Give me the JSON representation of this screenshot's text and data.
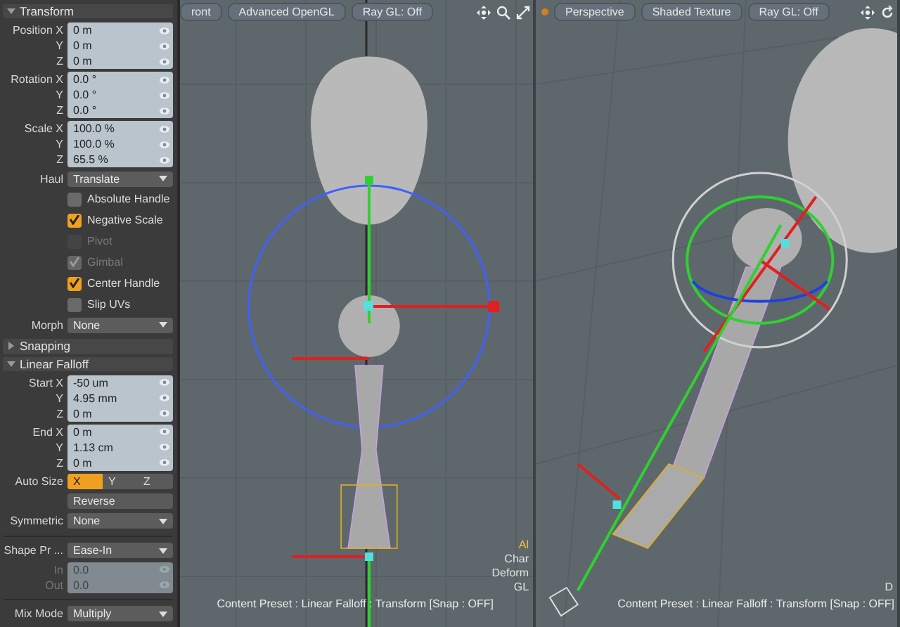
{
  "panel": {
    "sections": [
      {
        "title": "Transform",
        "expanded": true,
        "items": [
          {
            "kind": "vector",
            "disabled": false,
            "rows": [
              {
                "label": "Position X",
                "value": "0 m"
              },
              {
                "label": "Y",
                "value": "0 m"
              },
              {
                "label": "Z",
                "value": "0 m"
              }
            ]
          },
          {
            "kind": "vector",
            "disabled": false,
            "rows": [
              {
                "label": "Rotation X",
                "value": "0.0 °"
              },
              {
                "label": "Y",
                "value": "0.0 °"
              },
              {
                "label": "Z",
                "value": "0.0 °"
              }
            ]
          },
          {
            "kind": "vector",
            "disabled": false,
            "rows": [
              {
                "label": "Scale X",
                "value": "100.0 %"
              },
              {
                "label": "Y",
                "value": "100.0 %"
              },
              {
                "label": "Z",
                "value": "65.5 %"
              }
            ]
          },
          {
            "kind": "dropdown",
            "label": "Haul",
            "value": "Translate"
          },
          {
            "kind": "checkbox",
            "label": "Absolute Handle",
            "checked": false,
            "disabled": false
          },
          {
            "kind": "checkbox",
            "label": "Negative Scale",
            "checked": true,
            "disabled": false
          },
          {
            "kind": "checkbox",
            "label": "Pivot",
            "checked": false,
            "disabled": true
          },
          {
            "kind": "checkbox",
            "label": "Gimbal",
            "checked": true,
            "disabled": true
          },
          {
            "kind": "checkbox",
            "label": "Center Handle",
            "checked": true,
            "disabled": false
          },
          {
            "kind": "checkbox",
            "label": "Slip UVs",
            "checked": false,
            "disabled": false
          },
          {
            "kind": "dropdown",
            "label": "Morph",
            "value": "None"
          }
        ]
      },
      {
        "title": "Snapping",
        "expanded": false
      },
      {
        "title": "Linear Falloff",
        "expanded": true,
        "items": [
          {
            "kind": "vector",
            "disabled": false,
            "rows": [
              {
                "label": "Start X",
                "value": "-50 um"
              },
              {
                "label": "Y",
                "value": "4.95 mm"
              },
              {
                "label": "Z",
                "value": "0 m"
              }
            ]
          },
          {
            "kind": "vector",
            "disabled": false,
            "rows": [
              {
                "label": "End X",
                "value": "0 m"
              },
              {
                "label": "Y",
                "value": "1.13 cm"
              },
              {
                "label": "Z",
                "value": "0 m"
              }
            ]
          },
          {
            "kind": "segmented",
            "label": "Auto Size",
            "options": [
              {
                "label": "X",
                "selected": true
              },
              {
                "label": "Y",
                "selected": false
              },
              {
                "label": "Z",
                "selected": false
              }
            ]
          },
          {
            "kind": "button",
            "label": "Reverse"
          },
          {
            "kind": "dropdown",
            "label": "Symmetric",
            "value": "None"
          },
          {
            "kind": "divider"
          },
          {
            "kind": "dropdown",
            "label": "Shape Pr ...",
            "value": "Ease-In"
          },
          {
            "kind": "vector",
            "disabled": true,
            "rows": [
              {
                "label": "In",
                "value": "0.0"
              },
              {
                "label": "Out",
                "value": "0.0"
              }
            ]
          },
          {
            "kind": "divider"
          },
          {
            "kind": "dropdown",
            "label": "Mix Mode",
            "value": "Multiply"
          }
        ]
      }
    ]
  },
  "viewports": [
    {
      "kind": "ortho",
      "buttons": [
        "ront",
        "Advanced OpenGL",
        "Ray GL: Off"
      ],
      "overlay_labels": [
        {
          "text": "Al",
          "highlight": true
        },
        {
          "text": "Char",
          "highlight": false
        },
        {
          "text": "Deform",
          "highlight": false
        },
        {
          "text": "GL",
          "highlight": false
        }
      ],
      "status": "Content Preset : Linear Falloff : Transform  [Snap : OFF]"
    },
    {
      "kind": "perspective",
      "buttons": [
        "Perspective",
        "Shaded Texture",
        "Ray GL: Off"
      ],
      "overlay_labels": [
        {
          "text": "D",
          "highlight": false
        }
      ],
      "status": "Content Preset : Linear Falloff : Transform  [Snap : OFF]"
    }
  ]
}
